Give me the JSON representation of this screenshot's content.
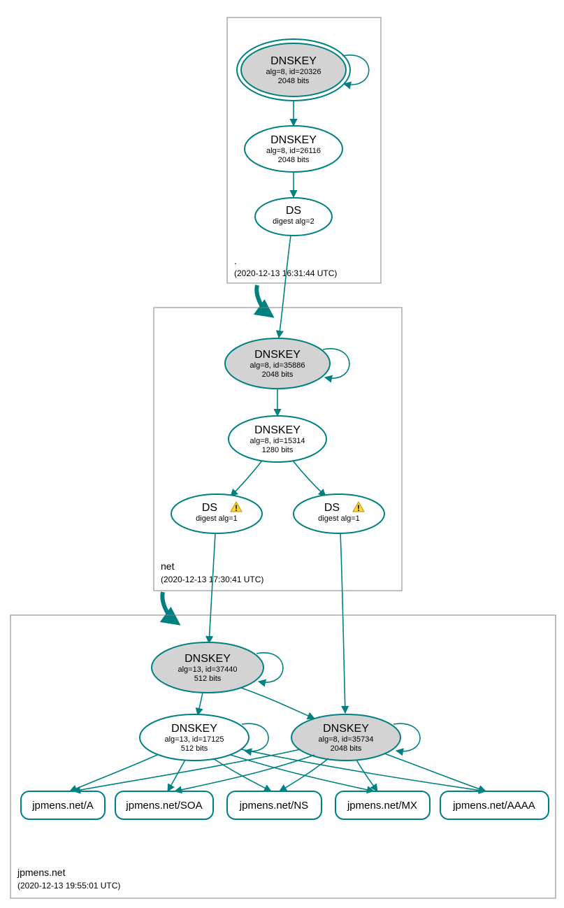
{
  "colors": {
    "stroke": "#008080",
    "fill_grey": "#d3d3d3",
    "box_stroke": "#808080",
    "warn_fill": "#ffd633",
    "warn_stroke": "#c09000"
  },
  "zones": {
    "root": {
      "label": ".",
      "timestamp": "(2020-12-13 16:31:44 UTC)"
    },
    "net": {
      "label": "net",
      "timestamp": "(2020-12-13 17:30:41 UTC)"
    },
    "jpmens": {
      "label": "jpmens.net",
      "timestamp": "(2020-12-13 19:55:01 UTC)"
    }
  },
  "nodes": {
    "root_ksk": {
      "title": "DNSKEY",
      "line2": "alg=8, id=20326",
      "line3": "2048 bits"
    },
    "root_zsk": {
      "title": "DNSKEY",
      "line2": "alg=8, id=26116",
      "line3": "2048 bits"
    },
    "root_ds": {
      "title": "DS",
      "line2": "digest alg=2",
      "line3": ""
    },
    "net_ksk": {
      "title": "DNSKEY",
      "line2": "alg=8, id=35886",
      "line3": "2048 bits"
    },
    "net_zsk": {
      "title": "DNSKEY",
      "line2": "alg=8, id=15314",
      "line3": "1280 bits"
    },
    "net_ds1": {
      "title": "DS",
      "line2": "digest alg=1",
      "line3": "",
      "warn": true
    },
    "net_ds2": {
      "title": "DS",
      "line2": "digest alg=1",
      "line3": "",
      "warn": true
    },
    "jp_ksk": {
      "title": "DNSKEY",
      "line2": "alg=13, id=37440",
      "line3": "512 bits"
    },
    "jp_zsk": {
      "title": "DNSKEY",
      "line2": "alg=13, id=17125",
      "line3": "512 bits"
    },
    "jp_key2": {
      "title": "DNSKEY",
      "line2": "alg=8, id=35734",
      "line3": "2048 bits"
    },
    "rr_a": {
      "label": "jpmens.net/A"
    },
    "rr_soa": {
      "label": "jpmens.net/SOA"
    },
    "rr_ns": {
      "label": "jpmens.net/NS"
    },
    "rr_mx": {
      "label": "jpmens.net/MX"
    },
    "rr_aaaa": {
      "label": "jpmens.net/AAAA"
    }
  }
}
